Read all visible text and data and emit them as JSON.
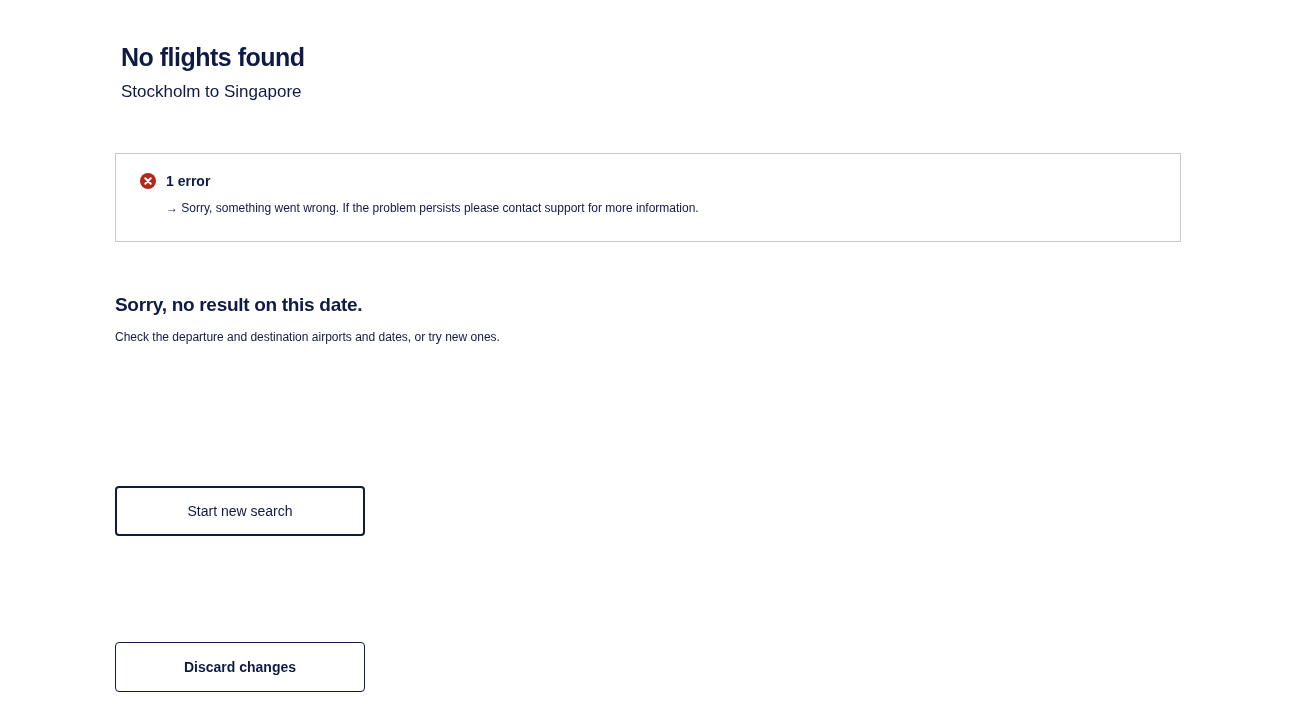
{
  "header": {
    "title": "No flights found",
    "subtitle": "Stockholm to Singapore"
  },
  "error_summary": {
    "count_label": "1 error",
    "messages": [
      "→ Sorry, something went wrong. If the problem persists please contact support for more information."
    ]
  },
  "empty_state": {
    "title": "Sorry, no result on this date.",
    "text": "Check the departure and destination airports and dates, or try new ones."
  },
  "buttons": [
    {
      "label": "Start new search",
      "kind": "primary"
    },
    {
      "label": "Discard changes",
      "kind": "secondary"
    }
  ]
}
